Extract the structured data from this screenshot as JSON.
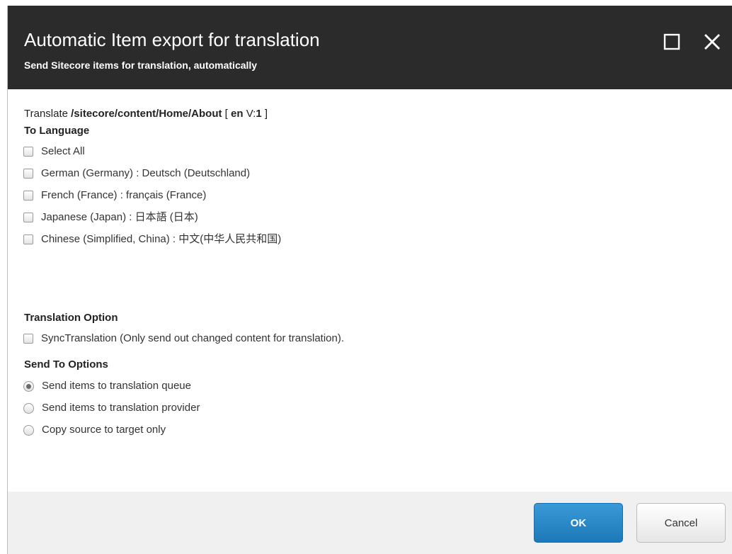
{
  "dialog": {
    "title": "Automatic Item export for translation",
    "subtitle": "Send Sitecore items for translation, automatically",
    "window_buttons": [
      "maximize-icon",
      "close-icon"
    ]
  },
  "translate": {
    "prefix": "Translate ",
    "path": "/sitecore/content/Home/About",
    "lang_open": " [ ",
    "lang": "en",
    "version_label": " V:",
    "version": "1",
    "close": " ]"
  },
  "to_language": {
    "heading": "To Language",
    "options": [
      {
        "label": "Select All",
        "checked": false
      },
      {
        "label": "German (Germany) : Deutsch (Deutschland)",
        "checked": false
      },
      {
        "label": "French (France) : français (France)",
        "checked": false
      },
      {
        "label": "Japanese (Japan) : 日本語 (日本)",
        "checked": false
      },
      {
        "label": "Chinese (Simplified, China) : 中文(中华人民共和国)",
        "checked": false
      }
    ]
  },
  "translation_option": {
    "heading": "Translation Option",
    "options": [
      {
        "label": "SyncTranslation (Only send out changed content for translation).",
        "checked": false
      }
    ]
  },
  "send_to": {
    "heading": "Send To Options",
    "options": [
      {
        "label": "Send items to translation queue",
        "selected": true
      },
      {
        "label": "Send items to translation provider",
        "selected": false
      },
      {
        "label": "Copy source to target only",
        "selected": false
      }
    ]
  },
  "footer": {
    "ok_label": "OK",
    "cancel_label": "Cancel"
  },
  "colors": {
    "header_bg": "#2b2b2b",
    "ok_button": "#2a87c8",
    "footer_bg": "#f0f0f0"
  }
}
